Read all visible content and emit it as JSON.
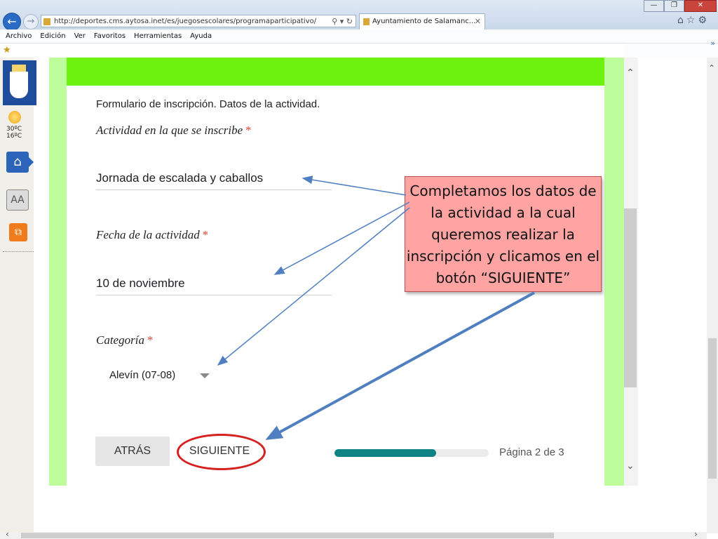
{
  "browser": {
    "url": "http://deportes.cms.aytosa.inet/es/juegosescolares/programaparticipativo/",
    "tab_title": "Ayuntamiento de Salamanc...",
    "menu": [
      "Archivo",
      "Edición",
      "Ver",
      "Favoritos",
      "Herramientas",
      "Ayuda"
    ]
  },
  "sidebar": {
    "weather": {
      "high": "30ºC",
      "low": "16ºC"
    },
    "text_icon_label": "AA"
  },
  "form": {
    "header": "Formulario de inscripción. Datos de la actividad.",
    "questions": [
      {
        "label": "Actividad en la que se inscribe",
        "required": "*",
        "answer": "Jornada de escalada y caballos"
      },
      {
        "label": "Fecha de la actividad",
        "required": "*",
        "answer": "10 de noviembre"
      },
      {
        "label": "Categoría",
        "required": "*",
        "answer": "Alevín (07-08)"
      }
    ],
    "back_label": "ATRÁS",
    "next_label": "SIGUIENTE",
    "page_indicator": "Página 2 de 3",
    "progress_fraction": 0.66
  },
  "callout": {
    "text": "Completamos los datos de la actividad a la cual queremos realizar la inscripción y clicamos en el botón “SIGUIENTE”"
  },
  "colors": {
    "header_band": "#6cf20e",
    "page_border": "#bdfd9b",
    "progress": "#0f8383",
    "required": "#db4437",
    "callout_bg": "#ffa3a3",
    "highlight": "#d62020"
  }
}
